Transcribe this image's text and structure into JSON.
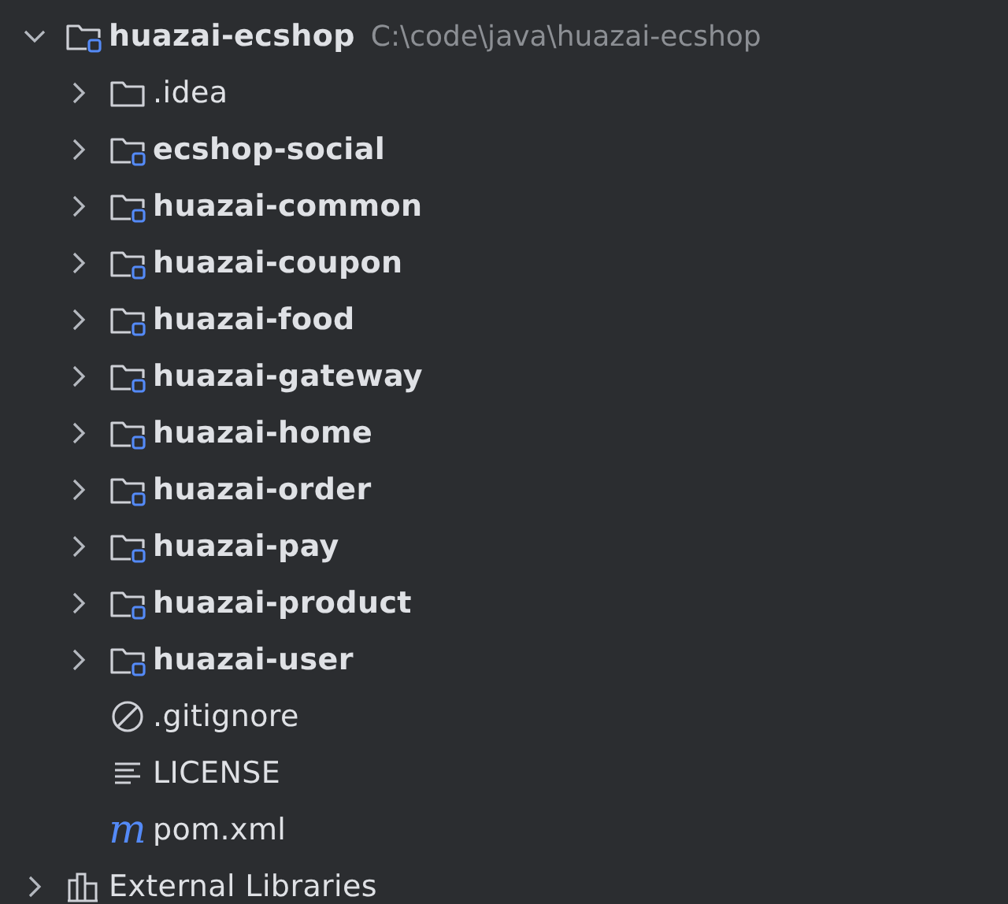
{
  "tree": [
    {
      "kind": "module",
      "label": "huazai-ecshop",
      "path": "C:\\code\\java\\huazai-ecshop",
      "expanded": true,
      "children": [
        {
          "kind": "folder",
          "label": ".idea",
          "expanded": false
        },
        {
          "kind": "module",
          "label": "ecshop-social",
          "expanded": false
        },
        {
          "kind": "module",
          "label": "huazai-common",
          "expanded": false
        },
        {
          "kind": "module",
          "label": "huazai-coupon",
          "expanded": false
        },
        {
          "kind": "module",
          "label": "huazai-food",
          "expanded": false
        },
        {
          "kind": "module",
          "label": "huazai-gateway",
          "expanded": false
        },
        {
          "kind": "module",
          "label": "huazai-home",
          "expanded": false
        },
        {
          "kind": "module",
          "label": "huazai-order",
          "expanded": false
        },
        {
          "kind": "module",
          "label": "huazai-pay",
          "expanded": false
        },
        {
          "kind": "module",
          "label": "huazai-product",
          "expanded": false
        },
        {
          "kind": "module",
          "label": "huazai-user",
          "expanded": false
        },
        {
          "kind": "ignore",
          "label": ".gitignore"
        },
        {
          "kind": "text",
          "label": "LICENSE"
        },
        {
          "kind": "maven",
          "label": "pom.xml",
          "glyph": "m"
        }
      ]
    },
    {
      "kind": "libraries",
      "label": "External Libraries",
      "expanded": false
    }
  ]
}
